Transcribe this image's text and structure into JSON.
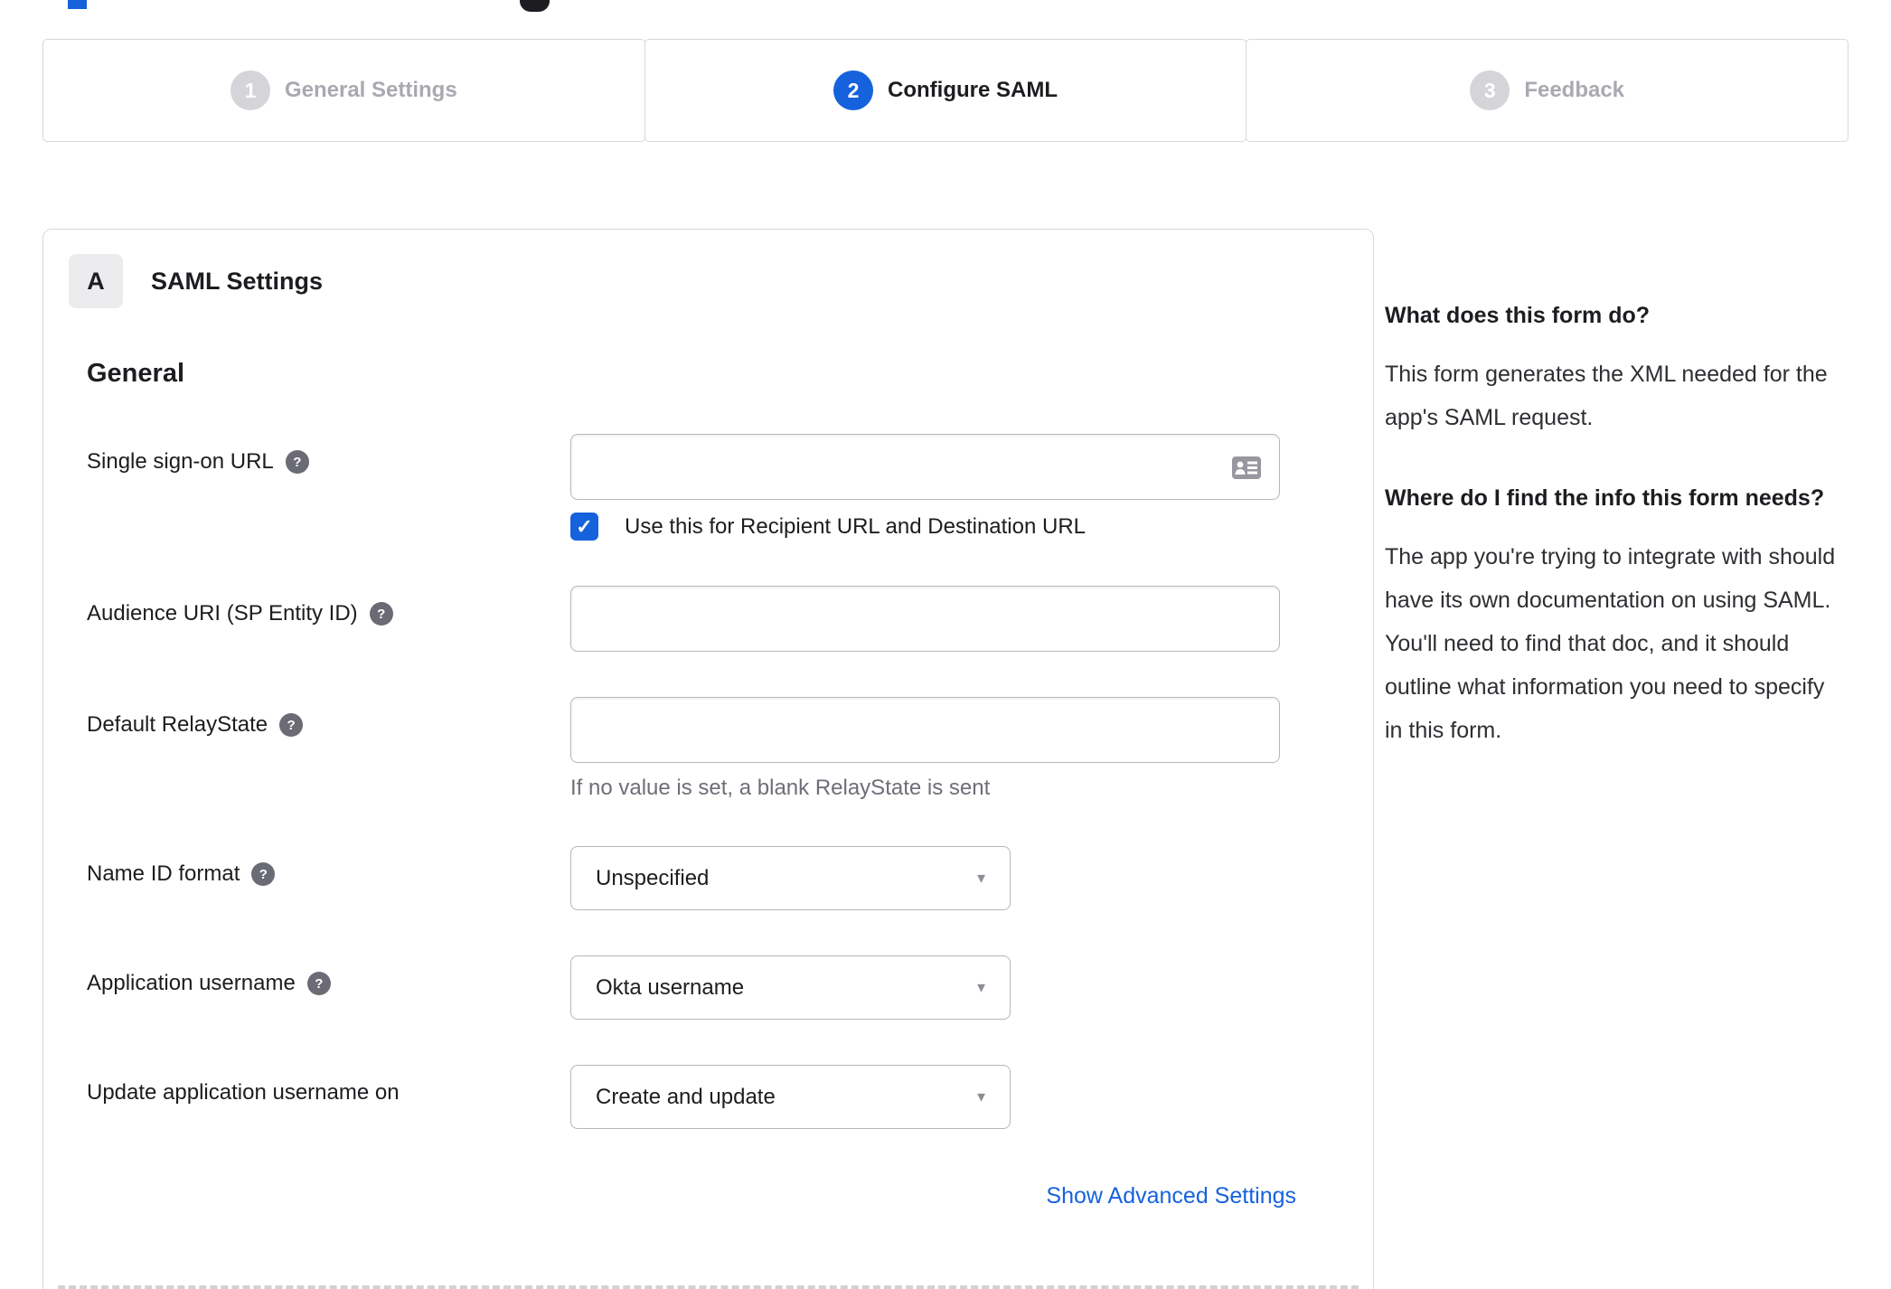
{
  "icons": {
    "help": "?",
    "check": "✓",
    "caret": "▼",
    "input_icon_name": "contact-card-icon"
  },
  "colors": {
    "accent_blue": "#1662dd",
    "link_blue": "#1662dd",
    "inactive_gray": "#d5d5d9",
    "border_gray": "#d8d8dc",
    "text_dark": "#1d1d21",
    "muted_text": "#6e6e78"
  },
  "stepper": {
    "steps": [
      {
        "number": "1",
        "label": "General Settings",
        "state": "inactive"
      },
      {
        "number": "2",
        "label": "Configure SAML",
        "state": "active"
      },
      {
        "number": "3",
        "label": "Feedback",
        "state": "inactive"
      }
    ]
  },
  "panel": {
    "badge": "A",
    "title": "SAML Settings",
    "section": "General",
    "fields": {
      "sso_url": {
        "label": "Single sign-on URL",
        "value": "",
        "placeholder": "",
        "checkbox": {
          "checked": true,
          "label": "Use this for Recipient URL and Destination URL"
        }
      },
      "audience_uri": {
        "label": "Audience URI (SP Entity ID)",
        "value": "",
        "placeholder": ""
      },
      "relay_state": {
        "label": "Default RelayState",
        "value": "",
        "placeholder": "",
        "helper": "If no value is set, a blank RelayState is sent"
      },
      "name_id_format": {
        "label": "Name ID format",
        "selected": "Unspecified"
      },
      "app_username": {
        "label": "Application username",
        "selected": "Okta username"
      },
      "update_app_username": {
        "label": "Update application username on",
        "selected": "Create and update"
      }
    },
    "advanced_link": "Show Advanced Settings"
  },
  "sidebar": {
    "sections": [
      {
        "heading": "What does this form do?",
        "body": "This form generates the XML needed for the app's SAML request."
      },
      {
        "heading": "Where do I find the info this form needs?",
        "body": "The app you're trying to integrate with should have its own documentation on using SAML. You'll need to find that doc, and it should outline what information you need to specify in this form."
      }
    ]
  }
}
